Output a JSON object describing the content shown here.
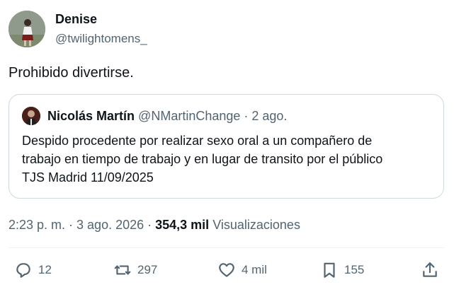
{
  "author": {
    "name": "Denise",
    "handle": "@twilightomens_"
  },
  "tweet": {
    "text": "Prohibido divertirse."
  },
  "quote": {
    "name": "Nicolás Martín",
    "handle_date": "@NMartinChange · 2 ago.",
    "lines": [
      "Despido procedente por realizar sexo oral a un compañero de",
      "trabajo en tiempo de trabajo y en lugar de transito por el público",
      "TJS Madrid 11/09/2025"
    ]
  },
  "meta": {
    "time_date": "2:23 p. m. · 3 ago. 2026 · ",
    "views_count": "354,3 mil",
    "views_label": "Visualizaciones"
  },
  "actions": {
    "replies": "12",
    "retweets": "297",
    "likes": "4 mil",
    "bookmarks": "155"
  },
  "colors": {
    "text": "#0f1419",
    "muted": "#536471",
    "border": "#cfd9de"
  }
}
